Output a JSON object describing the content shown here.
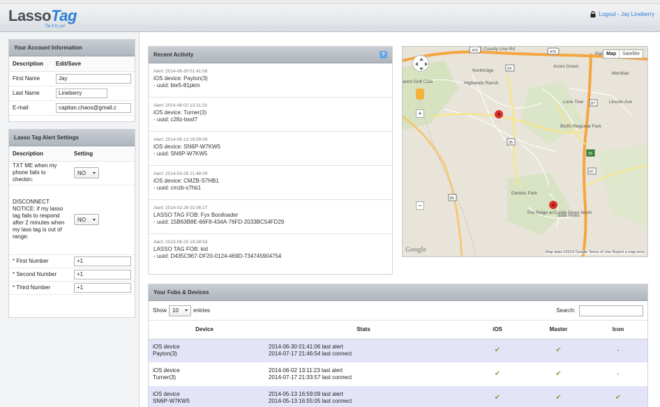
{
  "header": {
    "logo_text_a": "Lasso",
    "logo_text_b": "Tag",
    "tagline": "Tie it to ya!",
    "logout": "Logout - Jay Lineberry"
  },
  "account": {
    "title": "Your Account Information",
    "col_desc": "Description",
    "col_edit": "Edit/Save",
    "rows": [
      {
        "label": "First Name",
        "value": "Jay"
      },
      {
        "label": "Last Name",
        "value": "Lineberry"
      },
      {
        "label": "E-mail",
        "value": "capitan.chaos@gmail.c"
      }
    ]
  },
  "alerts": {
    "title": "Lasso Tag Alert Settings",
    "col_desc": "Description",
    "col_setting": "Setting",
    "txt_label": "TXT ME when my phone fails to checkin:",
    "txt_value": "NO",
    "disconnect_label": "DISCONNECT NOTICE: if my lasso tag fails to respond after 2 minutes when my lass tag is out of range:",
    "disconnect_value": "NO",
    "numbers": [
      {
        "label": "* First Number",
        "value": "+1"
      },
      {
        "label": "* Second Number",
        "value": "+1"
      },
      {
        "label": "* Third Number",
        "value": "+1"
      }
    ]
  },
  "activity": {
    "title": "Recent Activity",
    "help": "?",
    "items": [
      {
        "ts": "Alert: 2014-06-30 01:41:06",
        "device": "iOS device: Payton(3)",
        "uuid": "- uuid: bte5-81pkm"
      },
      {
        "ts": "Alert: 2014-06-02 13:11:23",
        "device": "iOS device: Turner(3)",
        "uuid": "- uuid: c28z-bssf7"
      },
      {
        "ts": "Alert: 2014-05-13 16:59:09",
        "device": "iOS device: SN6P-W7KW5",
        "uuid": "- uuid: SN6P-W7KW5"
      },
      {
        "ts": "Alert: 2014-03-26 21:48:09",
        "device": "iOS device: CMZB-S7HB1",
        "uuid": "- uuid: cmzb-s7hb1"
      },
      {
        "ts": "Alert: 2014-02-26 02:06:27",
        "device": "LASSO TAG FOB: Fyx Bootloader",
        "uuid": "- uuid: 15B63B8E-66F8-434A-76FD-2033BC54FD29"
      },
      {
        "ts": "Alert: 2013-08-25 19:28:53",
        "device": "LASSO TAG FOB: kid",
        "uuid": "- uuid: D435C967-DF20-0124-469D-734745904754"
      }
    ]
  },
  "map": {
    "btn_map": "Map",
    "btn_satellite": "Satellite",
    "labels": {
      "rd470a": "470",
      "rd470b": "470",
      "rd470c": "470",
      "county": "E County Line Rd",
      "park": "Park Meadows",
      "northridge": "Northridge",
      "rd24": "24",
      "acres": "Acres Green",
      "meridian": "Meridian",
      "golf": "anch Golf Club",
      "highlands": "Highlands Ranch",
      "lonetree": "Lone Tree",
      "rd87a": "87",
      "lincoln": "Lincoln Ave",
      "bluffs": "Bluffs Regional Park",
      "rd36": "36",
      "rd25": "25",
      "rd87b": "87",
      "rd85": "85",
      "daniels": "Daniels Park",
      "ridge": "The Ridge at Castle Pines North",
      "castle": "astle Pines",
      "google": "Google",
      "attribution": "Map data ©2014 Google  Terms of Use  Report a map error"
    }
  },
  "fobs": {
    "title": "Your Fobs & Devices",
    "show": "Show",
    "entries_value": "10",
    "entries": "entries",
    "search": "Search:",
    "columns": [
      "Device",
      "Stats",
      "iOS",
      "Master",
      "Icon"
    ],
    "rows": [
      {
        "device1": "iOS device",
        "device2": "Payton(3)",
        "stat1": "2014-06-30 01:41:06 last alert",
        "stat2": "2014-07-17 21:46:54 last connect",
        "ios": "✔",
        "master": "✔",
        "icon": "-"
      },
      {
        "device1": "iOS device",
        "device2": "Turner(3)",
        "stat1": "2014-06-02 13:11:23 last alert",
        "stat2": "2014-07-17 21:33:57 last connect",
        "ios": "✔",
        "master": "✔",
        "icon": "-"
      },
      {
        "device1": "iOS device",
        "device2": "SN6P-W7KW5",
        "stat1": "2014-05-13 16:59:09 last alert",
        "stat2": "2014-05-13 16:55:05 last connect",
        "ios": "✔",
        "master": "✔",
        "icon": "✔"
      }
    ]
  },
  "colors": {
    "accent": "#2c7fd4",
    "pin": "#d9322b",
    "check": "#74a540",
    "row_highlight": "#e3e4f7"
  }
}
